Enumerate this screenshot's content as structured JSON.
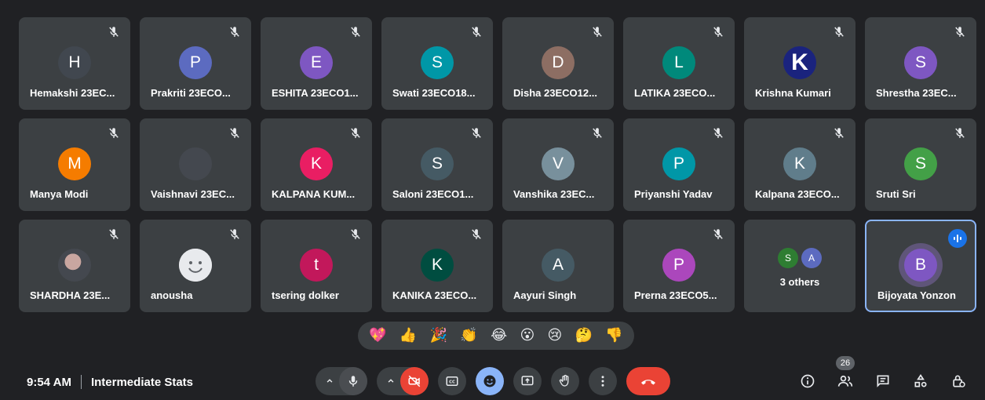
{
  "participants": [
    {
      "name": "Hemakshi 23EC...",
      "initial": "H",
      "color": "#41474f",
      "muted": true,
      "avatar": "initial"
    },
    {
      "name": "Prakriti 23ECO...",
      "initial": "P",
      "color": "#5c6bc0",
      "muted": true,
      "avatar": "initial"
    },
    {
      "name": "ESHITA 23ECO1...",
      "initial": "E",
      "color": "#7e57c2",
      "muted": true,
      "avatar": "initial"
    },
    {
      "name": "Swati 23ECO18...",
      "initial": "S",
      "color": "#0097a7",
      "muted": true,
      "avatar": "initial"
    },
    {
      "name": "Disha 23ECO12...",
      "initial": "D",
      "color": "#8d6e63",
      "muted": true,
      "avatar": "initial"
    },
    {
      "name": "LATIKA 23ECO...",
      "initial": "L",
      "color": "#00897b",
      "muted": true,
      "avatar": "initial"
    },
    {
      "name": "Krishna Kumari",
      "initial": "K",
      "color": "#1a237e",
      "muted": true,
      "avatar": "initial"
    },
    {
      "name": "Shrestha 23EC...",
      "initial": "S",
      "color": "#7e57c2",
      "muted": true,
      "avatar": "initial"
    },
    {
      "name": "Manya Modi",
      "initial": "M",
      "color": "#f57c00",
      "muted": true,
      "avatar": "initial"
    },
    {
      "name": "Vaishnavi 23EC...",
      "initial": "",
      "color": "#44484f",
      "muted": true,
      "avatar": "photo"
    },
    {
      "name": "KALPANA KUM...",
      "initial": "K",
      "color": "#e91e63",
      "muted": true,
      "avatar": "initial"
    },
    {
      "name": "Saloni 23ECO1...",
      "initial": "S",
      "color": "#455a64",
      "muted": true,
      "avatar": "initial"
    },
    {
      "name": "Vanshika 23EC...",
      "initial": "V",
      "color": "#78909c",
      "muted": true,
      "avatar": "initial"
    },
    {
      "name": "Priyanshi Yadav",
      "initial": "P",
      "color": "#0097a7",
      "muted": true,
      "avatar": "initial"
    },
    {
      "name": "Kalpana 23ECO...",
      "initial": "K",
      "color": "#607d8b",
      "muted": true,
      "avatar": "initial"
    },
    {
      "name": "Sruti Sri",
      "initial": "S",
      "color": "#43a047",
      "muted": true,
      "avatar": "initial"
    },
    {
      "name": "SHARDHA 23E...",
      "initial": "",
      "color": "#c9a6a0",
      "muted": true,
      "avatar": "photo"
    },
    {
      "name": "anousha",
      "initial": "",
      "color": "#e8eaed",
      "muted": true,
      "avatar": "smile"
    },
    {
      "name": "tsering dolker",
      "initial": "t",
      "color": "#c2185b",
      "muted": true,
      "avatar": "initial"
    },
    {
      "name": "KANIKA 23ECO...",
      "initial": "K",
      "color": "#004d40",
      "muted": true,
      "avatar": "initial"
    },
    {
      "name": "Aayuri Singh",
      "initial": "A",
      "color": "#455a64",
      "muted": false,
      "avatar": "initial"
    },
    {
      "name": "Prerna 23ECO5...",
      "initial": "P",
      "color": "#ab47bc",
      "muted": true,
      "avatar": "initial"
    }
  ],
  "others_tile": {
    "label": "3 others",
    "avatars": [
      {
        "initial": "S",
        "color": "#2e7d32"
      },
      {
        "initial": "A",
        "color": "#5c6bc0"
      }
    ]
  },
  "self_tile": {
    "name": "Bijoyata Yonzon",
    "initial": "B",
    "color": "#7e57c2",
    "speaking": true
  },
  "reactions": [
    "💖",
    "👍",
    "🎉",
    "👏",
    "😂",
    "😮",
    "😢",
    "🤔",
    "👎"
  ],
  "meeting": {
    "time": "9:54 AM",
    "title": "Intermediate Stats"
  },
  "participant_count": "26",
  "icons": {
    "mic": "microphone-icon",
    "camera_off": "camera-off-icon",
    "captions": "captions-icon",
    "emoji": "emoji-icon",
    "present": "present-screen-icon",
    "hand": "raise-hand-icon",
    "more": "more-options-icon",
    "end": "end-call-icon",
    "info": "info-icon",
    "people": "people-icon",
    "chat": "chat-icon",
    "activities": "activities-icon",
    "host": "host-controls-icon"
  }
}
